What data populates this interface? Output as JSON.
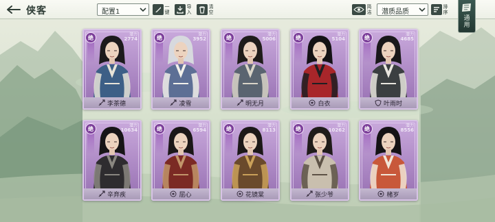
{
  "header": {
    "title": "侠客",
    "preset_value": "配置1",
    "buttons": {
      "one_click_label": "一键",
      "import_label": "导入",
      "clear_label": "清空",
      "simple_label": "简洁",
      "sort_label": "排序"
    },
    "filter_value": "潜质品质",
    "tongyong_label": "通用"
  },
  "cards": [
    {
      "name": "李茶德",
      "rank": "绝",
      "power_label": "潜力",
      "power": "2774",
      "faction": "sword",
      "colors": {
        "robe": "#3d5f86",
        "trim": "#e8e4d8",
        "hair": "#1c1a1c"
      }
    },
    {
      "name": "凌雪",
      "rank": "绝",
      "power_label": "潜力",
      "power": "3952",
      "faction": "sword",
      "colors": {
        "robe": "#5d6f95",
        "trim": "#f2f0ea",
        "hair": "#d7d9de"
      }
    },
    {
      "name": "明无月",
      "rank": "绝",
      "power_label": "潜力",
      "power": "5006",
      "faction": "sword",
      "colors": {
        "robe": "#5a6470",
        "trim": "#d9d4c8",
        "hair": "#1f1c1a"
      }
    },
    {
      "name": "白衣",
      "rank": "绝",
      "power_label": "潜力",
      "power": "5104",
      "faction": "circle",
      "colors": {
        "robe": "#a8262a",
        "trim": "#1f1f22",
        "hair": "#141214"
      }
    },
    {
      "name": "叶雨时",
      "rank": "绝",
      "power_label": "潜力",
      "power": "4685",
      "faction": "shield",
      "colors": {
        "robe": "#3b3f41",
        "trim": "#e9e6df",
        "hair": "#19181a"
      }
    },
    {
      "name": "辛弃疾",
      "rank": "绝",
      "power_label": "潜力",
      "power": "10634",
      "faction": "sword",
      "colors": {
        "robe": "#2e2c2f",
        "trim": "#8a8780",
        "hair": "#171517"
      }
    },
    {
      "name": "屈心",
      "rank": "绝",
      "power_label": "潜力",
      "power": "6594",
      "faction": "circle",
      "colors": {
        "robe": "#7b2a24",
        "trim": "#c2956a",
        "hair": "#1b1718"
      }
    },
    {
      "name": "花镜棠",
      "rank": "绝",
      "power_label": "潜力",
      "power": "8113",
      "faction": "circle",
      "colors": {
        "robe": "#6a4a2c",
        "trim": "#caa15a",
        "hair": "#1c1818"
      }
    },
    {
      "name": "张少爷",
      "rank": "绝",
      "power_label": "潜力",
      "power": "10262",
      "faction": "sword",
      "colors": {
        "robe": "#c9bfae",
        "trim": "#5c5145",
        "hair": "#201c1a"
      }
    },
    {
      "name": "楮岁",
      "rank": "绝",
      "power_label": "潜力",
      "power": "8556",
      "faction": "circle",
      "colors": {
        "robe": "#c8583a",
        "trim": "#f1e6d8",
        "hair": "#151315"
      }
    }
  ]
}
